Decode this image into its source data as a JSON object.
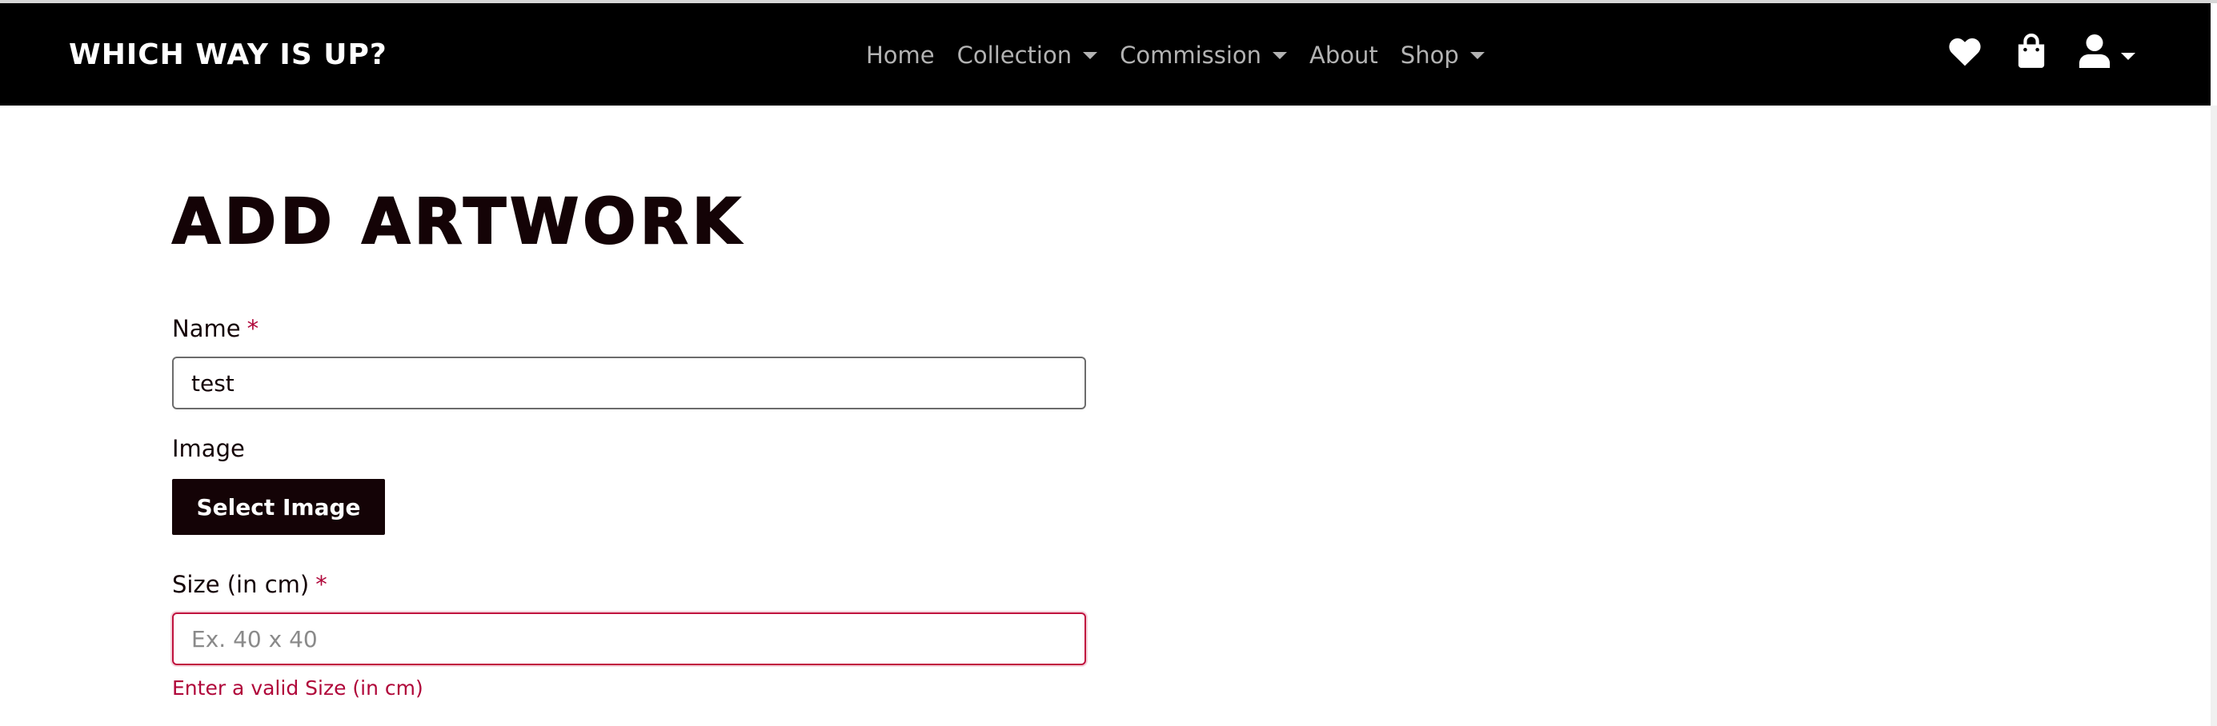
{
  "header": {
    "brand": "WHICH WAY IS UP?",
    "nav": {
      "home": "Home",
      "collection": "Collection",
      "commission": "Commission",
      "about": "About",
      "shop": "Shop"
    },
    "icons": [
      "heart-icon",
      "shopping-bag-icon",
      "user-icon"
    ]
  },
  "page": {
    "title": "ADD ARTWORK"
  },
  "form": {
    "name": {
      "label": "Name",
      "required_mark": "*",
      "value": "test"
    },
    "image": {
      "label": "Image",
      "button": "Select Image"
    },
    "size": {
      "label": "Size (in cm)",
      "required_mark": "*",
      "value": "",
      "placeholder": "Ex. 40 x 40",
      "error": "Enter a valid Size (in cm)"
    }
  },
  "colors": {
    "navbar_bg": "#000000",
    "brand_dark": "#140306",
    "error": "#b0073a",
    "nav_link": "#b3b3b3"
  }
}
